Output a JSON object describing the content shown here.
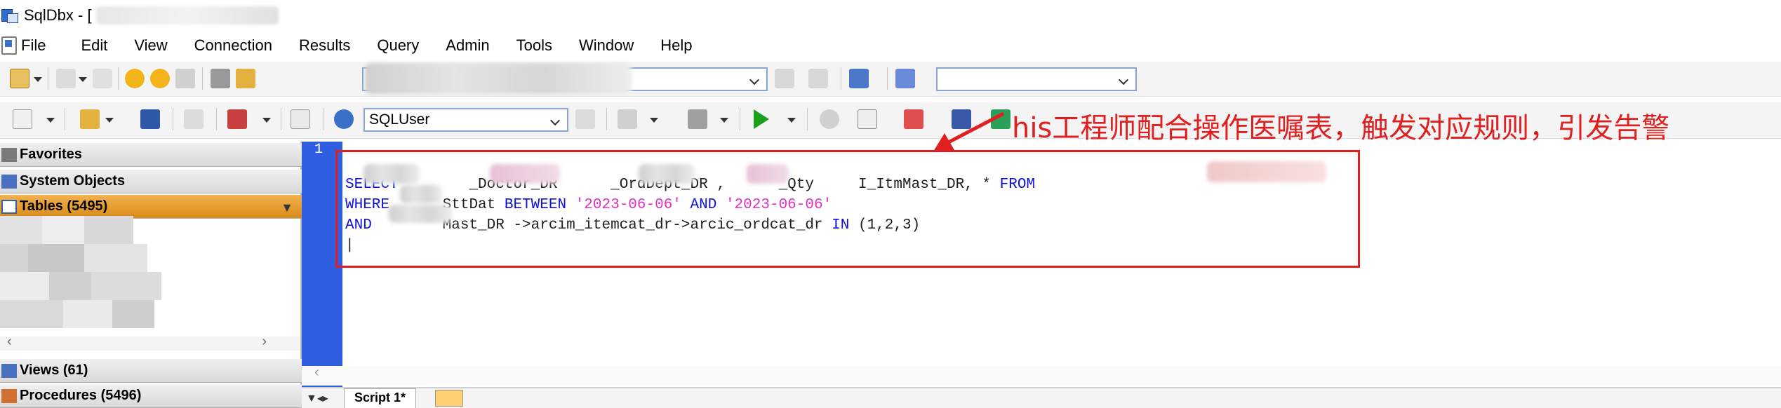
{
  "window": {
    "title": "SqlDbx - ["
  },
  "menu": {
    "items": [
      "File",
      "Edit",
      "View",
      "Connection",
      "Results",
      "Query",
      "Admin",
      "Tools",
      "Window",
      "Help"
    ]
  },
  "toolbar2": {
    "schema_combo": "SQLUser"
  },
  "left_pane": {
    "favorites": "Favorites",
    "system_objects": "System Objects",
    "tables": "Tables (5495)",
    "views": "Views (61)",
    "procedures": "Procedures (5496)"
  },
  "editor": {
    "line_number": "1",
    "line1": {
      "select": "SELECT",
      "p1": "_Doctor_DR",
      "p2": "_OrdDept_DR ,",
      "p3": "_Qty",
      "p4": "I_ItmMast_DR, * ",
      "from": "FROM"
    },
    "line2": {
      "where": "WHERE",
      "p1": "SttDat ",
      "between": "BETWEEN",
      "d1": "'2023-06-06'",
      "and": "AND",
      "d2": "'2023-06-06'"
    },
    "line3": {
      "and": "AND",
      "p1": "Mast_DR ->arcim_itemcat_dr->arcic_ordcat_dr ",
      "in": "IN",
      "p2": " (1,2,3)"
    }
  },
  "annotation": "his工程师配合操作医嘱表，触发对应规则，引发告警",
  "tabs": {
    "active": "Script 1*"
  },
  "colors": {
    "annotation": "#e02020",
    "gutter": "#2f5fe0",
    "keyword": "#1010d8",
    "string": "#e030c8",
    "active_header": "#e39a2a"
  }
}
